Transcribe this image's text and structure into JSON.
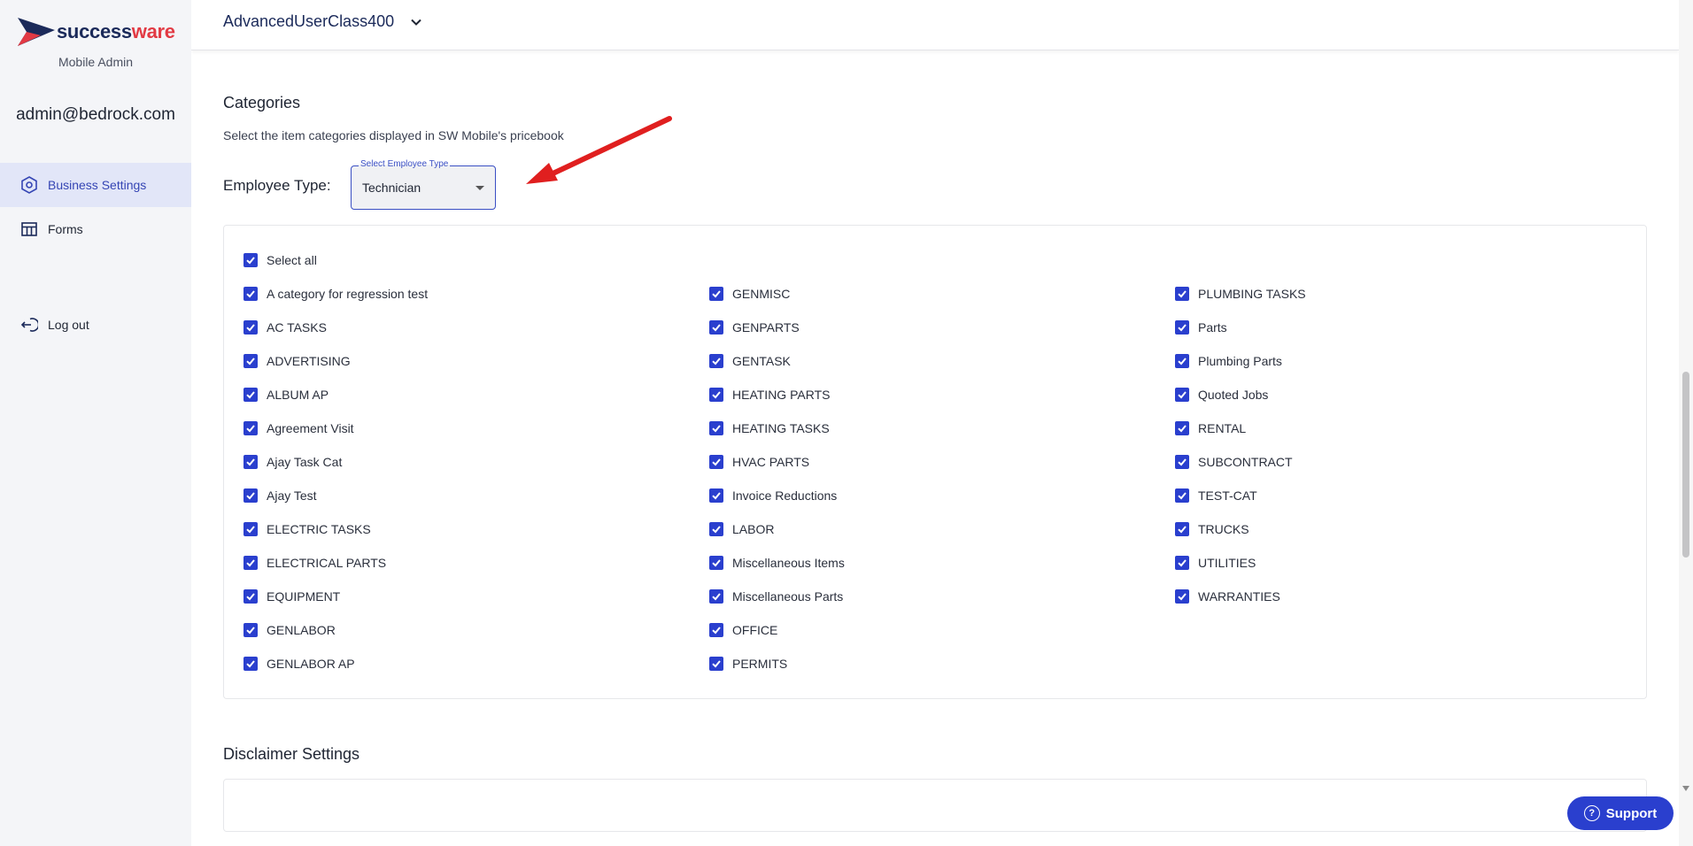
{
  "sidebar": {
    "brand_part1": "success",
    "brand_part2": "ware",
    "subtitle": "Mobile Admin",
    "user_email": "admin@bedrock.com",
    "nav": [
      {
        "label": "Business Settings",
        "icon": "hexagon-settings-icon",
        "active": true
      },
      {
        "label": "Forms",
        "icon": "table-icon",
        "active": false
      },
      {
        "label": "Log out",
        "icon": "logout-icon",
        "active": false
      }
    ]
  },
  "header": {
    "user_class": "AdvancedUserClass400"
  },
  "categories": {
    "title": "Categories",
    "description": "Select the item categories displayed in SW Mobile's pricebook",
    "employee_type_label": "Employee Type:",
    "employee_select": {
      "legend": "Select Employee Type",
      "value": "Technician"
    },
    "select_all_label": "Select all",
    "columns": [
      [
        "A category for regression test",
        "AC TASKS",
        "ADVERTISING",
        "ALBUM AP",
        "Agreement Visit",
        "Ajay Task Cat",
        "Ajay Test",
        "ELECTRIC TASKS",
        "ELECTRICAL PARTS",
        "EQUIPMENT",
        "GENLABOR",
        "GENLABOR AP"
      ],
      [
        "GENMISC",
        "GENPARTS",
        "GENTASK",
        "HEATING PARTS",
        "HEATING TASKS",
        "HVAC PARTS",
        "Invoice Reductions",
        "LABOR",
        "Miscellaneous Items",
        "Miscellaneous Parts",
        "OFFICE",
        "PERMITS"
      ],
      [
        "PLUMBING TASKS",
        "Parts",
        "Plumbing Parts",
        "Quoted Jobs",
        "RENTAL",
        "SUBCONTRACT",
        "TEST-CAT",
        "TRUCKS",
        "UTILITIES",
        "WARRANTIES"
      ]
    ]
  },
  "disclaimer": {
    "title": "Disclaimer Settings"
  },
  "support": {
    "label": "Support"
  },
  "colors": {
    "accent": "#2a3fce",
    "brand_dark": "#1b2a5a",
    "brand_red": "#e23a44",
    "annotation_arrow": "#e01f1f"
  }
}
